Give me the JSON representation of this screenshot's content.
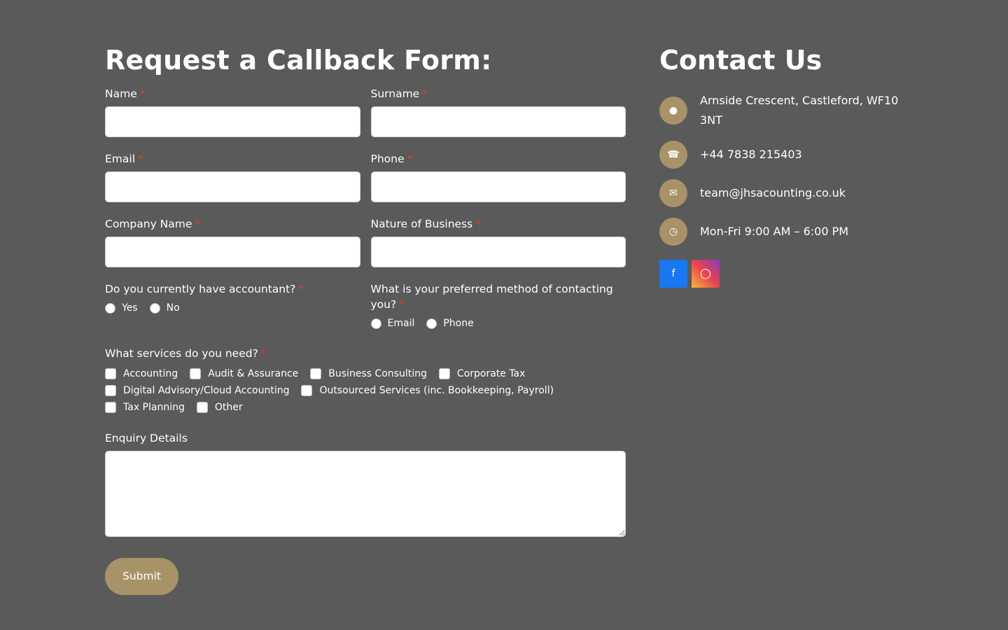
{
  "form": {
    "title": "Request a Callback Form:",
    "required_marker": "*",
    "fields": {
      "name": {
        "label": "Name",
        "value": ""
      },
      "surname": {
        "label": "Surname",
        "value": ""
      },
      "email": {
        "label": "Email",
        "value": ""
      },
      "phone": {
        "label": "Phone",
        "value": ""
      },
      "company": {
        "label": "Company Name",
        "value": ""
      },
      "business": {
        "label": "Nature of Business",
        "value": ""
      }
    },
    "accountant": {
      "question": "Do you currently have accountant?",
      "options": [
        "Yes",
        "No"
      ]
    },
    "contact_method": {
      "question": "What is your preferred method of contacting you?",
      "options": [
        "Email",
        "Phone"
      ]
    },
    "services": {
      "question": "What services do you need?",
      "options": [
        "Accounting",
        "Audit & Assurance",
        "Business Consulting",
        "Corporate Tax",
        "Digital Advisory/Cloud Accounting",
        "Outsourced Services (inc. Bookkeeping, Payroll)",
        "Tax Planning",
        "Other"
      ]
    },
    "enquiry": {
      "label": "Enquiry Details",
      "value": ""
    },
    "submit_label": "Submit"
  },
  "contact": {
    "title": "Contact Us",
    "items": [
      {
        "icon": "map-marker-icon",
        "text": "Arnside Crescent, Castleford, WF10 3NT"
      },
      {
        "icon": "phone-icon",
        "text": "+44 7838 215403"
      },
      {
        "icon": "envelope-icon",
        "text": "team@jhsacounting.co.uk"
      },
      {
        "icon": "clock-icon",
        "text": "Mon-Fri 9:00 AM – 6:00 PM"
      }
    ],
    "social": [
      {
        "icon": "facebook-icon"
      },
      {
        "icon": "instagram-icon"
      }
    ]
  },
  "colors": {
    "background": "#5a5a5a",
    "accent": "#a89268",
    "required": "#e63b2e",
    "facebook": "#1877f2"
  }
}
